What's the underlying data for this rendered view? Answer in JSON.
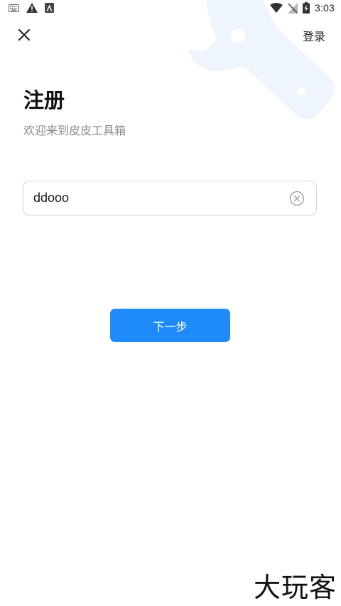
{
  "status_bar": {
    "time": "3:03",
    "icons": [
      "keyboard-icon",
      "warning-icon",
      "app-notification-icon",
      "wifi-icon",
      "no-sim-icon",
      "battery-charging-icon"
    ]
  },
  "header": {
    "close_icon": "close-icon",
    "login_label": "登录"
  },
  "main": {
    "title": "注册",
    "subtitle": "欢迎来到皮皮工具箱",
    "username_input": {
      "value": "ddooo",
      "clear_icon": "clear-circle-icon"
    },
    "next_button_label": "下一步"
  },
  "watermark_text": "大玩客",
  "colors": {
    "accent": "#1f8bfa",
    "subtitle_gray": "#8a8a8a",
    "watermark_wrench": "#eef5fd"
  }
}
